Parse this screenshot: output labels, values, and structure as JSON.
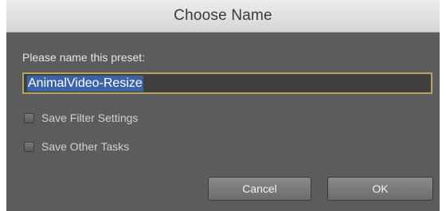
{
  "dialog": {
    "title": "Choose Name",
    "prompt": "Please name this preset:",
    "preset_name": "AnimalVideo-Resize",
    "options": [
      {
        "label": "Save Filter Settings",
        "checked": false
      },
      {
        "label": "Save Other Tasks",
        "checked": false
      }
    ],
    "buttons": {
      "cancel": "Cancel",
      "ok": "OK"
    }
  }
}
